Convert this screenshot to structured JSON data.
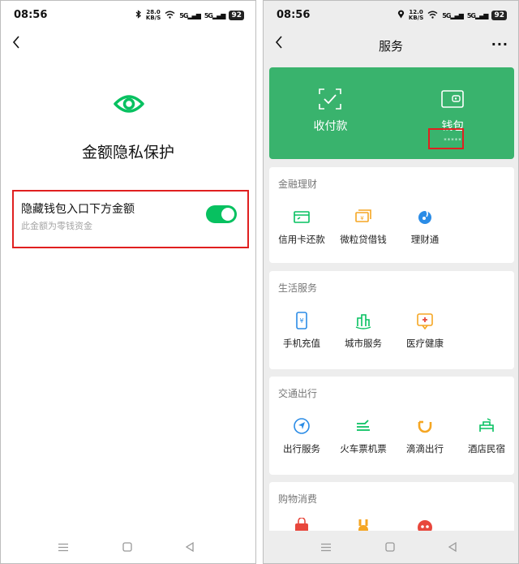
{
  "left": {
    "status": {
      "time": "08:56",
      "speed_value": "28.0",
      "speed_unit": "KB/S",
      "signal1": "5G",
      "signal2": "5G",
      "battery": "92"
    },
    "title": "金额隐私保护",
    "setting": {
      "title": "隐藏钱包入口下方金额",
      "subtitle": "此金额为零钱资金",
      "enabled": true
    }
  },
  "right": {
    "status": {
      "time": "08:56",
      "speed_value": "12.0",
      "speed_unit": "KB/S",
      "signal1": "5G",
      "signal2": "5G",
      "battery": "92"
    },
    "header": {
      "title": "服务",
      "more": "···"
    },
    "card": {
      "pay_label": "收付款",
      "wallet_label": "钱包",
      "wallet_amount": "*****"
    },
    "sections": [
      {
        "title": "金融理财",
        "items": [
          {
            "label": "信用卡还款",
            "icon": "credit-card-icon"
          },
          {
            "label": "微粒贷借钱",
            "icon": "loan-icon"
          },
          {
            "label": "理财通",
            "icon": "wealth-icon"
          }
        ]
      },
      {
        "title": "生活服务",
        "items": [
          {
            "label": "手机充值",
            "icon": "phone-topup-icon"
          },
          {
            "label": "城市服务",
            "icon": "city-icon"
          },
          {
            "label": "医疗健康",
            "icon": "medical-icon"
          }
        ]
      },
      {
        "title": "交通出行",
        "items": [
          {
            "label": "出行服务",
            "icon": "navigation-icon"
          },
          {
            "label": "火车票机票",
            "icon": "train-icon"
          },
          {
            "label": "滴滴出行",
            "icon": "didi-icon"
          },
          {
            "label": "酒店民宿",
            "icon": "hotel-icon"
          }
        ]
      },
      {
        "title": "购物消费",
        "items": []
      }
    ]
  },
  "colors": {
    "brand_green": "#07c160",
    "card_green": "#39b36d",
    "highlight_red": "#e02020",
    "icon_green": "#07c160",
    "icon_orange": "#f5a623",
    "icon_blue": "#2b8ce6",
    "icon_red": "#e8473c"
  }
}
